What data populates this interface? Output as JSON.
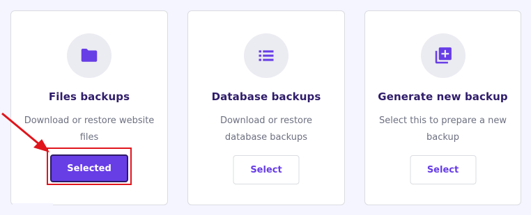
{
  "colors": {
    "accent": "#673de6",
    "title": "#2f1c6a",
    "muted": "#6d7081",
    "annotation": "#e0151c"
  },
  "cards": [
    {
      "icon": "folder-icon",
      "title": "Files backups",
      "description": "Download or restore website files",
      "button_label": "Selected",
      "selected": true
    },
    {
      "icon": "list-icon",
      "title": "Database backups",
      "description": "Download or restore database backups",
      "button_label": "Select",
      "selected": false
    },
    {
      "icon": "add-backup-icon",
      "title": "Generate new backup",
      "description": "Select this to prepare a new backup",
      "button_label": "Select",
      "selected": false
    }
  ]
}
